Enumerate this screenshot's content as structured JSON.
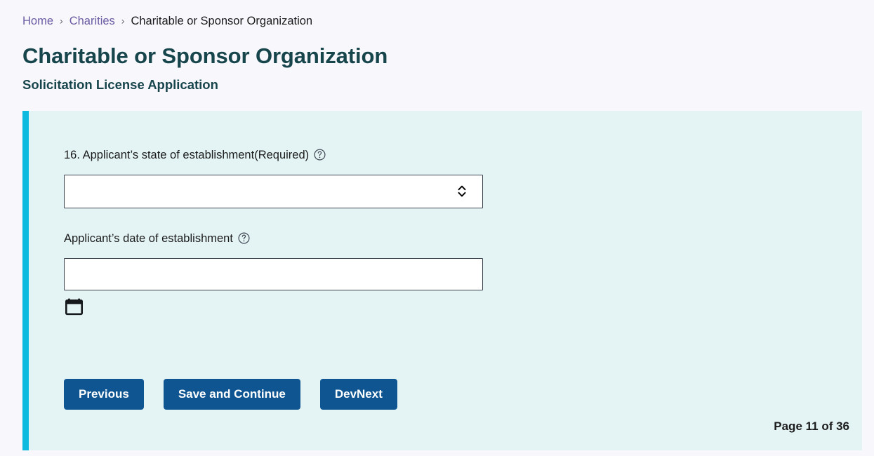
{
  "breadcrumb": {
    "items": [
      {
        "label": "Home",
        "type": "link"
      },
      {
        "label": "Charities",
        "type": "link"
      },
      {
        "label": "Charitable or Sponsor Organization",
        "type": "current"
      }
    ],
    "separator": "›",
    "link_color": "#6c5ca3"
  },
  "header": {
    "title": "Charitable or Sponsor Organization",
    "subtitle": "Solicitation License Application",
    "title_color": "#17454c"
  },
  "panel": {
    "accent_color": "#0cbae0",
    "background_color": "#e4f4f5"
  },
  "form": {
    "fields": [
      {
        "label": "16. Applicant’s state of establishment(Required)",
        "help_icon": "help-circle-icon",
        "control": "select",
        "value": "",
        "placeholder": ""
      },
      {
        "label": "Applicant’s date of establishment",
        "help_icon": "help-circle-icon",
        "control": "text",
        "value": "",
        "placeholder": "",
        "calendar_icon": "calendar-icon"
      }
    ]
  },
  "actions": {
    "buttons": [
      {
        "label": "Previous",
        "name": "previous-button"
      },
      {
        "label": "Save and Continue",
        "name": "save-and-continue-button"
      },
      {
        "label": "DevNext",
        "name": "dev-next-button"
      }
    ],
    "button_color": "#0e5592"
  },
  "footer": {
    "page_counter": "Page 11 of 36",
    "current_page": 11,
    "total_pages": 36
  }
}
